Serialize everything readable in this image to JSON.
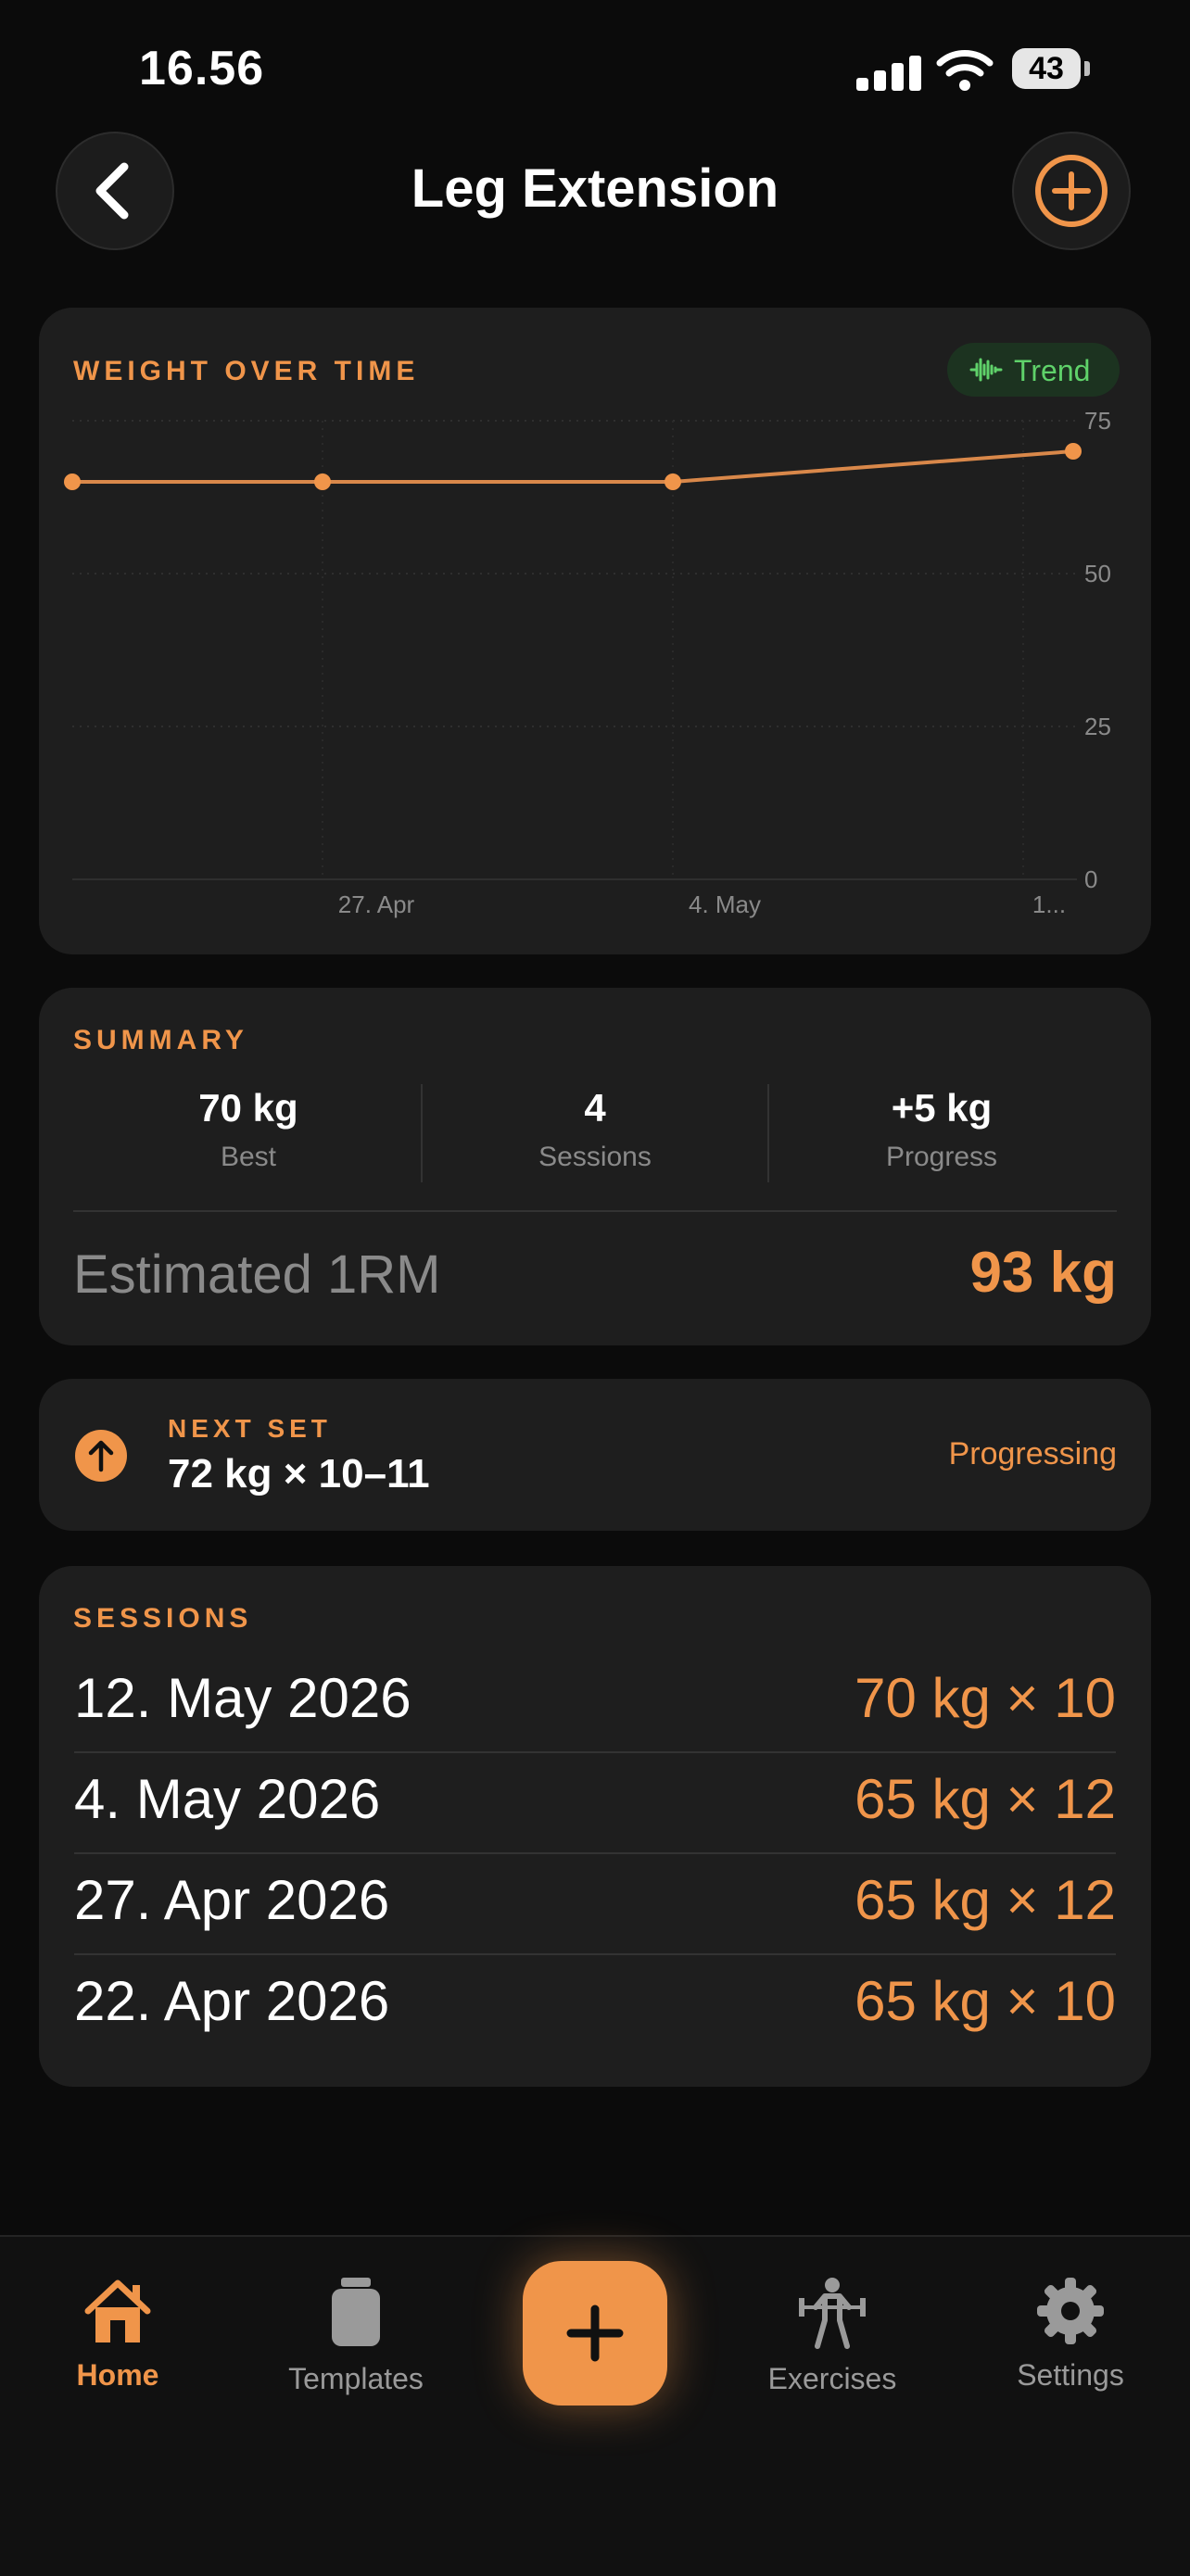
{
  "status_bar": {
    "time": "16.56",
    "battery": "43"
  },
  "header": {
    "title": "Leg Extension"
  },
  "chart_card": {
    "label": "WEIGHT OVER TIME",
    "trend_label": "Trend",
    "y_ticks": [
      "75",
      "50",
      "25",
      "0"
    ],
    "x_ticks": [
      "27. Apr",
      "4. May",
      "1..."
    ]
  },
  "chart_data": {
    "type": "line",
    "x": [
      "22. Apr 2026",
      "27. Apr 2026",
      "4. May 2026",
      "12. May 2026"
    ],
    "values": [
      65,
      65,
      65,
      70
    ],
    "ylim": [
      0,
      75
    ],
    "y_ticks": [
      0,
      25,
      50,
      75
    ],
    "x_tick_labels": [
      "27. Apr",
      "4. May",
      "1..."
    ],
    "title": "WEIGHT OVER TIME",
    "color": "#f0954a",
    "grid": true
  },
  "summary": {
    "label": "SUMMARY",
    "best_value": "70 kg",
    "best_label": "Best",
    "sessions_value": "4",
    "sessions_label": "Sessions",
    "progress_value": "+5 kg",
    "progress_label": "Progress",
    "one_rm_label": "Estimated 1RM",
    "one_rm_value": "93 kg"
  },
  "next_set": {
    "label": "NEXT SET",
    "value": "72 kg × 10–11",
    "status": "Progressing"
  },
  "sessions": {
    "label": "SESSIONS",
    "rows": [
      {
        "date": "12. May 2026",
        "value": "70 kg × 10"
      },
      {
        "date": "4. May 2026",
        "value": "65 kg × 12"
      },
      {
        "date": "27. Apr 2026",
        "value": "65 kg × 12"
      },
      {
        "date": "22. Apr 2026",
        "value": "65 kg × 10"
      }
    ]
  },
  "tabbar": {
    "home": "Home",
    "templates": "Templates",
    "exercises": "Exercises",
    "settings": "Settings"
  },
  "colors": {
    "accent": "#f0954a",
    "trend_green": "#5fd26a",
    "card": "#1e1e1e",
    "background": "#0b0b0b"
  }
}
